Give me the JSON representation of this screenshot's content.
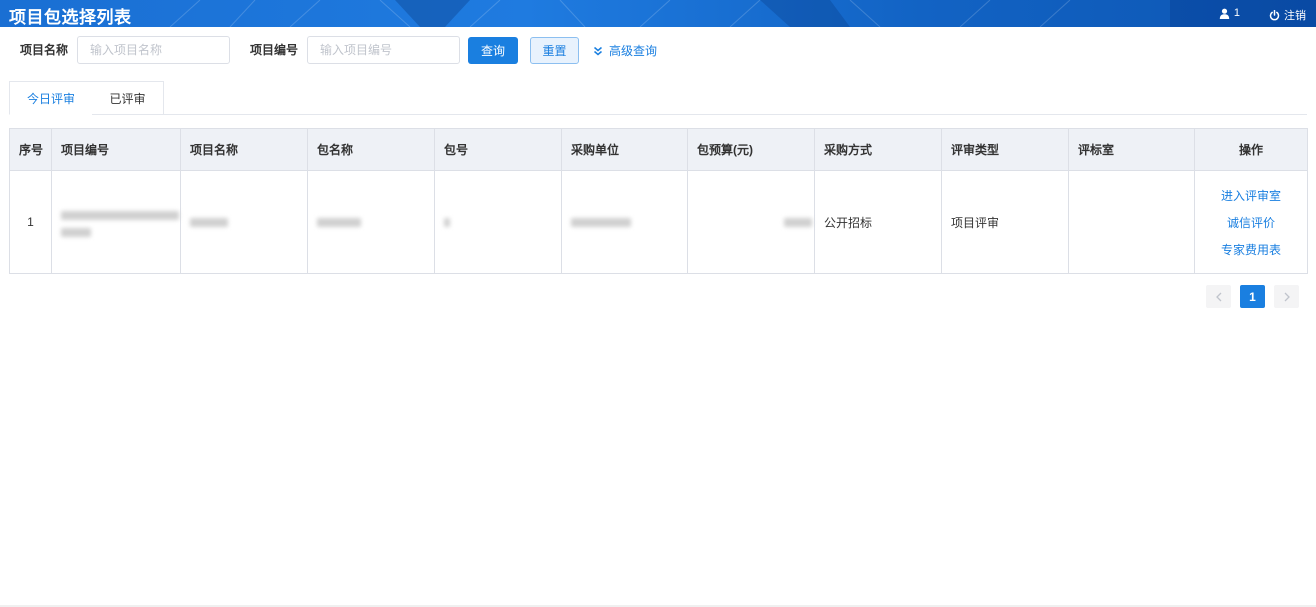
{
  "header": {
    "title": "项目包选择列表",
    "user_count": "1",
    "logout_label": "注销"
  },
  "search": {
    "name_label": "项目名称",
    "name_placeholder": "输入项目名称",
    "name_value": "",
    "code_label": "项目编号",
    "code_placeholder": "输入项目编号",
    "code_value": "",
    "query_label": "查询",
    "reset_label": "重置",
    "advanced_label": "高级查询"
  },
  "tabs": [
    {
      "label": "今日评审",
      "active": true
    },
    {
      "label": "已评审",
      "active": false
    }
  ],
  "table": {
    "columns": [
      "序号",
      "项目编号",
      "项目名称",
      "包名称",
      "包号",
      "采购单位",
      "包预算(元)",
      "采购方式",
      "评审类型",
      "评标室",
      "操作"
    ],
    "rows": [
      {
        "index": "1",
        "procurement_method": "公开招标",
        "review_type": "项目评审",
        "room": "",
        "actions": [
          "进入评审室",
          "诚信评价",
          "专家费用表"
        ]
      }
    ]
  },
  "pagination": {
    "current_page": "1",
    "prev_icon": "chevron-left-icon",
    "next_icon": "chevron-right-icon"
  },
  "colors": {
    "accent": "#1a7fe0",
    "header_bg": "#1f7be0",
    "table_header_bg": "#eef1f6"
  }
}
